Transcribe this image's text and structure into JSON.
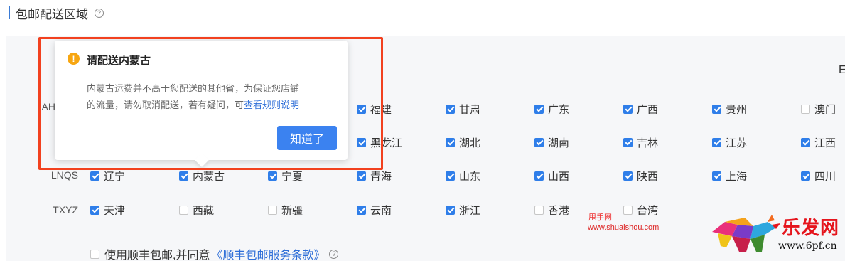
{
  "header": {
    "title": "包邮配送区域",
    "help_icon": "question-circle-icon"
  },
  "right_edge_text": "E",
  "rows": [
    {
      "label": "AH",
      "items": [
        {
          "name": "福建",
          "checked": true
        },
        {
          "name": "甘肃",
          "checked": true
        },
        {
          "name": "广东",
          "checked": true
        },
        {
          "name": "广西",
          "checked": true
        },
        {
          "name": "贵州",
          "checked": true
        },
        {
          "name": "澳门",
          "checked": false
        }
      ]
    },
    {
      "label": "",
      "items": [
        {
          "name": "黑龙江",
          "checked": true
        },
        {
          "name": "湖北",
          "checked": true
        },
        {
          "name": "湖南",
          "checked": true
        },
        {
          "name": "吉林",
          "checked": true
        },
        {
          "name": "江苏",
          "checked": true
        },
        {
          "name": "江西",
          "checked": true
        }
      ]
    },
    {
      "label": "LNQS",
      "items": [
        {
          "name": "辽宁",
          "checked": true
        },
        {
          "name": "内蒙古",
          "checked": true
        },
        {
          "name": "宁夏",
          "checked": true
        },
        {
          "name": "青海",
          "checked": true
        },
        {
          "name": "山东",
          "checked": true
        },
        {
          "name": "山西",
          "checked": true
        },
        {
          "name": "陕西",
          "checked": true
        },
        {
          "name": "上海",
          "checked": true
        },
        {
          "name": "四川",
          "checked": true
        }
      ]
    },
    {
      "label": "TXYZ",
      "items": [
        {
          "name": "天津",
          "checked": true
        },
        {
          "name": "西藏",
          "checked": false
        },
        {
          "name": "新疆",
          "checked": false
        },
        {
          "name": "云南",
          "checked": true
        },
        {
          "name": "浙江",
          "checked": true
        },
        {
          "name": "香港",
          "checked": false
        },
        {
          "name": "台湾",
          "checked": false
        }
      ]
    }
  ],
  "popover": {
    "icon": "warning-icon",
    "title": "请配送内蒙古",
    "body_line1": "内蒙古运费并不高于您配送的其他省，为保证您店铺",
    "body_line2": "的流量，请勿取消配送，若有疑问，可",
    "rule_link": "查看规则说明",
    "ok_label": "知道了"
  },
  "footer": {
    "agree_text": "使用顺丰包邮,并同意",
    "terms_link": "《顺丰包邮服务条款》",
    "help_icon": "question-circle-icon",
    "checked": false
  },
  "watermarks": {
    "text1": "甩手网",
    "text2": "www.shuaishou.com",
    "brand": "乐发网",
    "site": "www.6pf.cn"
  },
  "colors": {
    "accent": "#2f7ee9",
    "warning": "#f7a611",
    "highlight": "#f2411f",
    "link": "#2f6fd8"
  }
}
